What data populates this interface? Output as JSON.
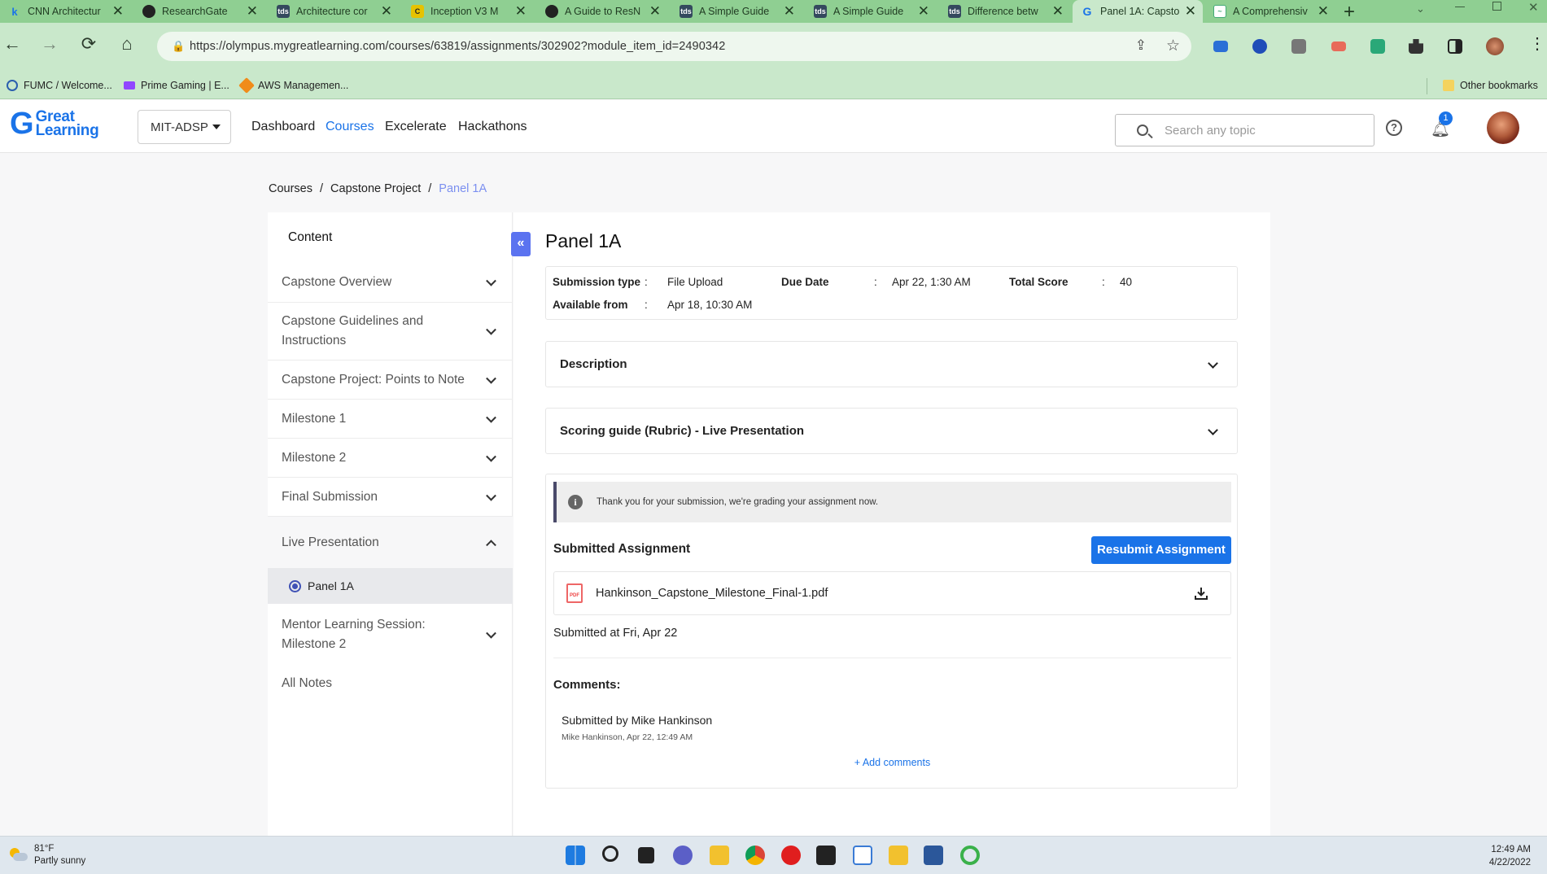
{
  "browser": {
    "tabs": [
      {
        "title": "CNN Architectur",
        "icon": "k",
        "color": "#1a73e8"
      },
      {
        "title": "ResearchGate",
        "icon": "rg",
        "color": "#222"
      },
      {
        "title": "Architecture cor",
        "icon": "tds",
        "color": "#34495e"
      },
      {
        "title": "Inception V3 M",
        "icon": "ce",
        "color": "#e6c200"
      },
      {
        "title": "A Guide to ResN",
        "icon": "o",
        "color": "#222"
      },
      {
        "title": "A Simple Guide",
        "icon": "tds",
        "color": "#34495e"
      },
      {
        "title": "A Simple Guide",
        "icon": "tds",
        "color": "#34495e"
      },
      {
        "title": "Difference betw",
        "icon": "tds",
        "color": "#34495e"
      },
      {
        "title": "Panel 1A: Capsto",
        "icon": "G",
        "color": "#1a73e8",
        "active": true
      },
      {
        "title": "A Comprehensiv",
        "icon": "chart",
        "color": "#4a7"
      }
    ],
    "url": "https://olympus.mygreatlearning.com/courses/63819/assignments/302902?module_item_id=2490342",
    "bookmarks": [
      "FUMC / Welcome...",
      "Prime Gaming | E...",
      "AWS Managemen..."
    ],
    "other_bookmarks": "Other bookmarks"
  },
  "header": {
    "logo_line1": "Great",
    "logo_line2": "Learning",
    "program": "MIT-ADSP",
    "nav": [
      "Dashboard",
      "Courses",
      "Excelerate",
      "Hackathons"
    ],
    "active_nav": "Courses",
    "search_placeholder": "Search any topic",
    "notification_count": "1"
  },
  "breadcrumb": {
    "items": [
      "Courses",
      "Capstone Project"
    ],
    "current": "Panel 1A",
    "separator": "/"
  },
  "sidebar": {
    "heading": "Content",
    "items": [
      "Capstone Overview",
      "Capstone Guidelines and Instructions",
      "Capstone Project: Points to Note",
      "Milestone 1",
      "Milestone 2",
      "Final Submission",
      "Live Presentation",
      "Mentor Learning Session: Milestone 2",
      "All Notes"
    ],
    "active_sub_item": "Panel 1A"
  },
  "assignment": {
    "title": "Panel 1A",
    "submission_type_label": "Submission type",
    "submission_type": "File Upload",
    "due_date_label": "Due Date",
    "due_date": "Apr 22, 1:30 AM",
    "total_score_label": "Total Score",
    "total_score": "40",
    "available_from_label": "Available from",
    "available_from": "Apr 18, 10:30 AM",
    "colon": ":",
    "description_label": "Description",
    "rubric_label": "Scoring guide (Rubric) - Live Presentation",
    "info_message": "Thank you for your submission, we're grading your assignment now.",
    "submitted_heading": "Submitted Assignment",
    "resubmit_label": "Resubmit Assignment",
    "file_name": "Hankinson_Capstone_Milestone_Final-1.pdf",
    "submitted_at": "Submitted at Fri, Apr 22",
    "comments_heading": "Comments:",
    "comment_by": "Submitted by Mike Hankinson",
    "comment_meta": "Mike Hankinson, Apr 22, 12:49 AM",
    "add_comments": "+ Add comments"
  },
  "taskbar": {
    "temperature": "81°F",
    "weather": "Partly sunny",
    "time": "12:49 AM",
    "date": "4/22/2022"
  },
  "colors": {
    "accent": "#1a73e8",
    "tabbar": "#8fcf92",
    "toolbar": "#c9e8cb"
  }
}
